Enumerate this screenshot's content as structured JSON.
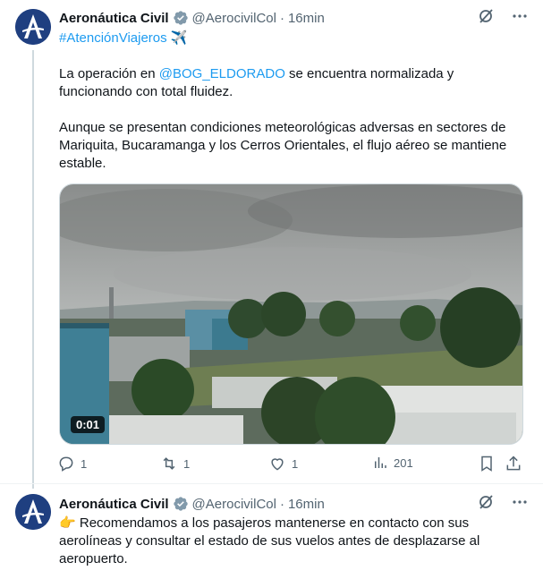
{
  "tweets": [
    {
      "author_name": "Aeronáutica Civil",
      "handle": "@AerocivilCol",
      "separator": "·",
      "time": "16min",
      "hashtag": "#AtenciónViajeros",
      "hashtag_emoji": "✈️",
      "p1_before": "La operación en ",
      "p1_mention": "@BOG_ELDORADO",
      "p1_after": " se encuentra normalizada y funcionando con total fluidez.",
      "p2": "Aunque se presentan condiciones meteorológicas adversas en sectores de Mariquita, Bucaramanga y los Cerros Orientales, el flujo aéreo se mantiene estable.",
      "video_duration": "0:01",
      "replies": "1",
      "reposts": "1",
      "likes": "1",
      "views": "201"
    },
    {
      "author_name": "Aeronáutica Civil",
      "handle": "@AerocivilCol",
      "separator": "·",
      "time": "16min",
      "emoji": "👉",
      "text": " Recomendamos a los pasajeros mantenerse en contacto con sus aerolíneas y consultar el estado de sus vuelos antes de desplazarse al aeropuerto."
    }
  ],
  "colors": {
    "link": "#1d9bf0",
    "secondary_text": "#536471",
    "verified": "#829aab",
    "avatar_bg": "#1f3f80"
  }
}
